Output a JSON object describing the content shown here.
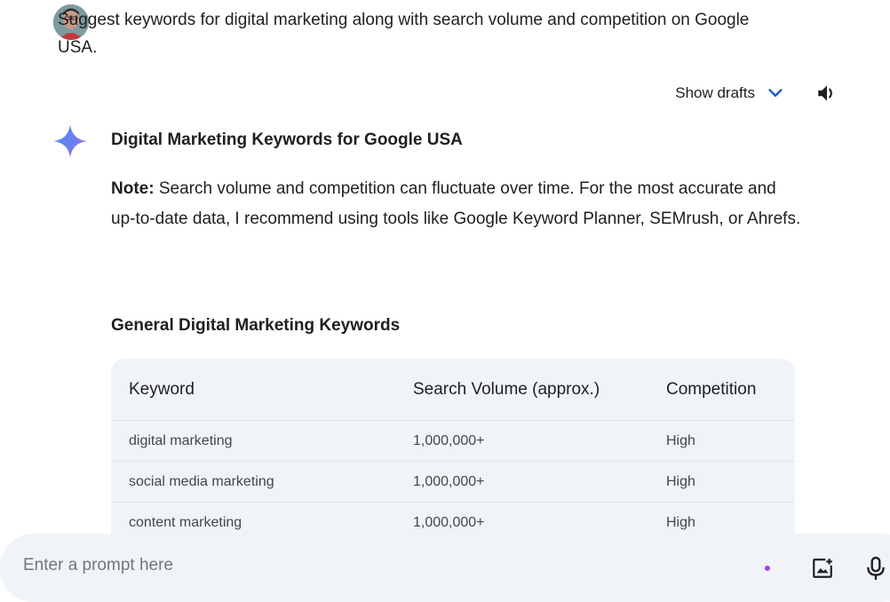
{
  "user": {
    "message": "Suggest keywords for digital marketing along with search volume and competition on Google USA."
  },
  "drafts": {
    "label": "Show drafts"
  },
  "response": {
    "title": "Digital Marketing Keywords for Google USA",
    "note_label": "Note:",
    "note_text": " Search volume and competition can fluctuate over time. For the most accurate and up-to-date data, I recommend using tools like Google Keyword Planner, SEMrush, or Ahrefs.",
    "section_title": "General Digital Marketing Keywords",
    "table": {
      "headers": [
        "Keyword",
        "Search Volume (approx.)",
        "Competition"
      ],
      "rows": [
        [
          "digital marketing",
          "1,000,000+",
          "High"
        ],
        [
          "social media marketing",
          "1,000,000+",
          "High"
        ],
        [
          "content marketing",
          "1,000,000+",
          "High"
        ]
      ]
    }
  },
  "prompt": {
    "placeholder": "Enter a prompt here"
  },
  "icons": {
    "chevron": "chevron-down-icon",
    "speaker": "speaker-icon",
    "spark": "gemini-spark-icon",
    "image": "add-image-icon",
    "mic": "microphone-icon"
  },
  "colors": {
    "accent_blue": "#0b57d0",
    "surface": "#f0f4f9",
    "dot_purple": "#a142f4"
  }
}
